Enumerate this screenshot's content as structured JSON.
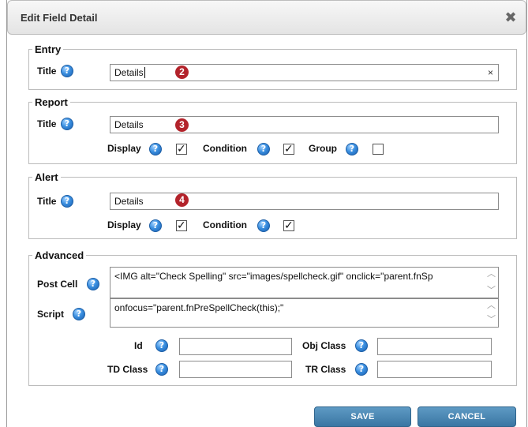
{
  "dialog": {
    "title": "Edit Field Detail",
    "close_icon": "close-icon"
  },
  "entry": {
    "legend": "Entry",
    "title_label": "Title",
    "title_value": "Details",
    "clear_glyph": "×",
    "marker": "2"
  },
  "report": {
    "legend": "Report",
    "title_label": "Title",
    "title_value": "Details",
    "marker": "3",
    "display_label": "Display",
    "display_checked": true,
    "condition_label": "Condition",
    "condition_checked": true,
    "group_label": "Group",
    "group_checked": false
  },
  "alert": {
    "legend": "Alert",
    "title_label": "Title",
    "title_value": "Details",
    "marker": "4",
    "display_label": "Display",
    "display_checked": true,
    "condition_label": "Condition",
    "condition_checked": true
  },
  "advanced": {
    "legend": "Advanced",
    "post_cell_label": "Post Cell",
    "post_cell_value": "<IMG alt=\"Check Spelling\" src=\"images/spellcheck.gif\" onclick=\"parent.fnSp",
    "script_label": "Script",
    "script_value": "onfocus=\"parent.fnPreSpellCheck(this);\"",
    "id_label": "Id",
    "id_value": "",
    "obj_class_label": "Obj Class",
    "obj_class_value": "",
    "td_class_label": "TD Class",
    "td_class_value": "",
    "tr_class_label": "TR Class",
    "tr_class_value": ""
  },
  "help_glyph": "?",
  "check_glyph": "✓",
  "scroll_up_glyph": "︿",
  "scroll_down_glyph": "﹀",
  "buttons": {
    "save": "SAVE",
    "cancel": "CANCEL"
  },
  "colors": {
    "accent_button": "#4a86b3",
    "marker": "#b3232b",
    "help_icon": "#3a8fe0"
  }
}
